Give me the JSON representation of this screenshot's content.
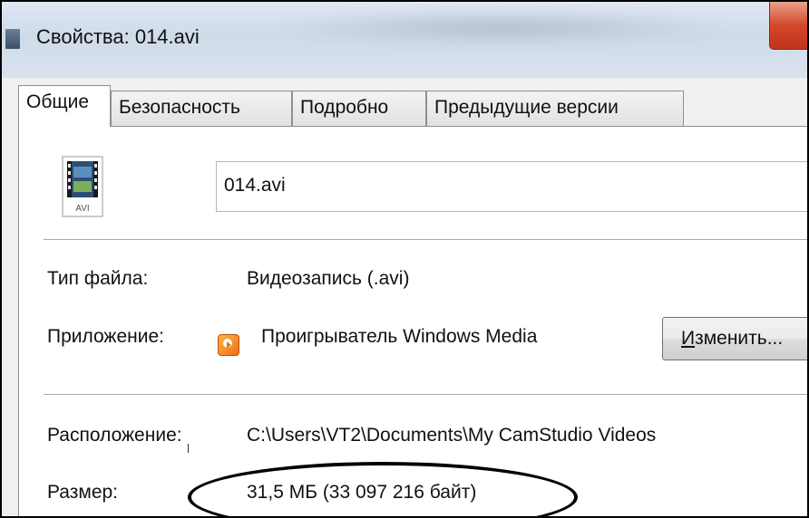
{
  "window": {
    "title": "Свойства: 014.avi",
    "icon": "properties-window-icon",
    "close_icon": "close-icon"
  },
  "tabs": [
    {
      "label": "Общие",
      "active": true
    },
    {
      "label": "Безопасность",
      "active": false
    },
    {
      "label": "Подробно",
      "active": false
    },
    {
      "label": "Предыдущие версии",
      "active": false
    }
  ],
  "general": {
    "file_icon": "avi-file-icon",
    "file_icon_caption": "AVI",
    "file_name": "014.avi",
    "file_type_label": "Тип файла:",
    "file_type_value": "Видеозапись (.avi)",
    "app_label": "Приложение:",
    "app_icon": "windows-media-player-icon",
    "app_value": "Проигрыватель Windows Media",
    "change_button": {
      "accel": "И",
      "rest": "зменить..."
    },
    "location_label": "Расположение:",
    "location_value": "C:\\Users\\VT2\\Documents\\My CamStudio Videos",
    "size_label": "Размер:",
    "size_value": "31,5 МБ (33 097 216 байт)"
  },
  "colors": {
    "close_button": "#d2482a",
    "annotation": "#000000"
  }
}
